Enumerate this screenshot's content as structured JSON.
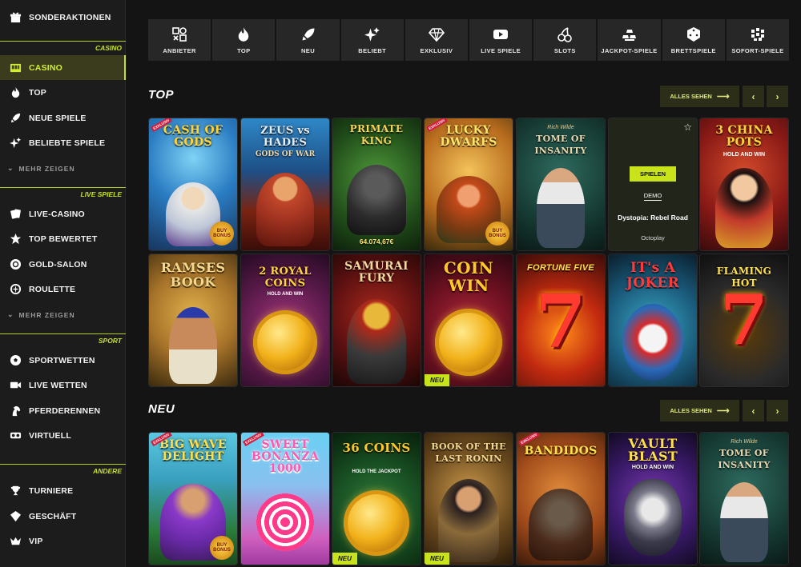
{
  "sidebar": {
    "top_item": {
      "label": "SONDERAKTIONEN",
      "icon": "gift-icon"
    },
    "sections": {
      "casino": "CASINO",
      "live": "LIVE SPIELE",
      "sport": "SPORT",
      "other": "ANDERE"
    },
    "casino_items": [
      {
        "label": "CASINO",
        "icon": "slot-machine-icon",
        "active": true
      },
      {
        "label": "TOP",
        "icon": "fire-icon"
      },
      {
        "label": "NEUE SPIELE",
        "icon": "rocket-icon"
      },
      {
        "label": "BELIEBTE SPIELE",
        "icon": "sparkle-icon"
      }
    ],
    "live_items": [
      {
        "label": "LIVE-CASINO",
        "icon": "cards-icon"
      },
      {
        "label": "TOP BEWERTET",
        "icon": "star-icon"
      },
      {
        "label": "GOLD-SALON",
        "icon": "chip-icon"
      },
      {
        "label": "ROULETTE",
        "icon": "roulette-icon"
      }
    ],
    "sport_items": [
      {
        "label": "SPORTWETTEN",
        "icon": "football-icon"
      },
      {
        "label": "LIVE WETTEN",
        "icon": "video-camera-icon"
      },
      {
        "label": "PFERDERENNEN",
        "icon": "horse-icon"
      },
      {
        "label": "VIRTUELL",
        "icon": "vr-headset-icon"
      }
    ],
    "other_items": [
      {
        "label": "TURNIERE",
        "icon": "trophy-icon"
      },
      {
        "label": "GESCHÄFT",
        "icon": "shop-icon"
      },
      {
        "label": "VIP",
        "icon": "crown-icon"
      }
    ],
    "show_more": "MEHR ZEIGEN"
  },
  "categories": [
    {
      "label": "ANBIETER",
      "icon": "providers-icon"
    },
    {
      "label": "TOP",
      "icon": "fire-icon"
    },
    {
      "label": "NEU",
      "icon": "rocket-icon"
    },
    {
      "label": "BELIEBT",
      "icon": "sparkle-icon"
    },
    {
      "label": "EXKLUSIV",
      "icon": "diamond-icon"
    },
    {
      "label": "LIVE SPIELE",
      "icon": "play-icon"
    },
    {
      "label": "SLOTS",
      "icon": "cherry-icon"
    },
    {
      "label": "JACKPOT-SPIELE",
      "icon": "gold-bars-icon"
    },
    {
      "label": "BRETTSPIELE",
      "icon": "dice-icon"
    },
    {
      "label": "SOFORT-SPIELE",
      "icon": "instant-icon"
    }
  ],
  "top_section": {
    "title": "TOP",
    "see_all": "ALLES SEHEN",
    "row1": [
      {
        "title": "CASH OF GODS",
        "badge": "EXKLUSIV",
        "buy_bonus": "BUY BONUS",
        "colors": [
          "#3fa7d8",
          "#1a3e7a"
        ]
      },
      {
        "title": "ZEUS vs HADES",
        "subtitle": "GODS OF WAR",
        "colors": [
          "#2a7ab8",
          "#4a1710"
        ]
      },
      {
        "title": "PRIMATE KING",
        "jackpot": "64.074,67€",
        "colors": [
          "#2f6e2a",
          "#132b12"
        ]
      },
      {
        "title": "LUCKY DWARFS",
        "badge": "EXKLUSIV",
        "buy_bonus": "BUY BONUS",
        "colors": [
          "#c98a22",
          "#3a3012"
        ]
      },
      {
        "title": "TOME OF INSANITY",
        "provider_tag": "Rich Wilde",
        "colors": [
          "#1f4a42",
          "#0c1d1a"
        ]
      },
      {
        "demo": true,
        "play_label": "SPIELEN",
        "demo_label": "DEMO",
        "name": "Dystopia: Rebel Road",
        "provider": "Octoplay",
        "star": "☆"
      },
      {
        "title": "3 CHINA POTS",
        "subtitle": "HOLD AND WIN",
        "colors": [
          "#b0321e",
          "#3d0b10"
        ]
      }
    ],
    "row2": [
      {
        "title": "RAMSES BOOK",
        "colors": [
          "#c9952f",
          "#3a2a0e"
        ]
      },
      {
        "title": "2 ROYAL COINS",
        "subtitle": "HOLD AND WIN",
        "colors": [
          "#6d1e5a",
          "#2a0c2a"
        ]
      },
      {
        "title": "SAMURAI FURY",
        "colors": [
          "#7a1a1a",
          "#210808"
        ]
      },
      {
        "title": "COIN WIN",
        "neu": "NEU",
        "colors": [
          "#8a1a2a",
          "#2a0812"
        ]
      },
      {
        "title": "FORTUNE FIVE",
        "colors": [
          "#a3261a",
          "#3a0c08"
        ]
      },
      {
        "title": "IT's A JOKER",
        "colors": [
          "#1f6a8a",
          "#0c2233"
        ]
      },
      {
        "title": "FLAMING HOT",
        "colors": [
          "#2a2a2a",
          "#0f0f0f"
        ]
      }
    ]
  },
  "new_section": {
    "title": "NEU",
    "see_all": "ALLES SEHEN",
    "row1": [
      {
        "title": "BIG WAVE DELIGHT",
        "badge": "EXKLUSIV",
        "buy_bonus": "BUY BONUS",
        "colors": [
          "#3fb7c8",
          "#1e5a2a"
        ]
      },
      {
        "title": "SWEET BONANZA 1000",
        "badge": "EXKLUSIV",
        "colors": [
          "#58c0ee",
          "#b044a8"
        ]
      },
      {
        "title": "36 COINS",
        "subtitle": "HOLD THE JACKPOT",
        "neu": "NEU",
        "colors": [
          "#1d5a2c",
          "#0a2412"
        ]
      },
      {
        "title": "BOOK OF THE LAST RONIN",
        "neu": "NEU",
        "colors": [
          "#7a5a2a",
          "#2a1a0c"
        ]
      },
      {
        "title": "BANDIDOS",
        "badge": "EXKLUSIV",
        "colors": [
          "#b8621e",
          "#3a1a0c"
        ]
      },
      {
        "title": "VAULT BLAST",
        "subtitle": "HOLD AND WIN",
        "colors": [
          "#5a2a8a",
          "#1a0c2a"
        ]
      },
      {
        "title": "TOME OF INSANITY",
        "provider_tag": "Rich Wilde",
        "colors": [
          "#1f4a42",
          "#0c1d1a"
        ]
      }
    ]
  },
  "colors": {
    "accent": "#c8e21c",
    "bg": "#141414",
    "sidebar": "#1c1c1c",
    "tile_bar": "#272727"
  }
}
